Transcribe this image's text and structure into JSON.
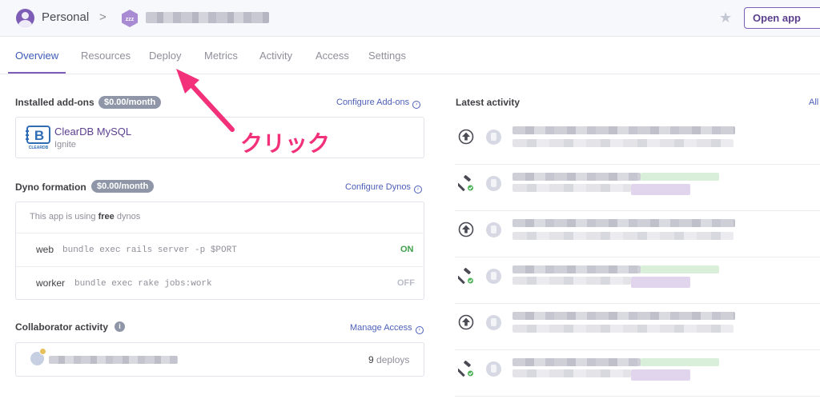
{
  "header": {
    "account_label": "Personal",
    "breadcrumb_separator": ">",
    "app_badge_text": "zzz",
    "open_app_label": "Open app"
  },
  "tabs": [
    {
      "label": "Overview",
      "active": true
    },
    {
      "label": "Resources",
      "active": false
    },
    {
      "label": "Deploy",
      "active": false
    },
    {
      "label": "Metrics",
      "active": false
    },
    {
      "label": "Activity",
      "active": false
    },
    {
      "label": "Access",
      "active": false
    },
    {
      "label": "Settings",
      "active": false
    }
  ],
  "addons": {
    "title": "Installed add-ons",
    "price": "$0.00/month",
    "link": "Configure Add-ons",
    "items": [
      {
        "name": "ClearDB MySQL",
        "plan": "Ignite",
        "logo_text": "CLEARDB",
        "logo_letter": "B"
      }
    ]
  },
  "dynos": {
    "title": "Dyno formation",
    "price": "$0.00/month",
    "link": "Configure Dynos",
    "note_prefix": "This app is using ",
    "note_bold": "free",
    "note_suffix": " dynos",
    "items": [
      {
        "type": "web",
        "command": "bundle exec rails server -p $PORT",
        "state": "ON"
      },
      {
        "type": "worker",
        "command": "bundle exec rake jobs:work",
        "state": "OFF"
      }
    ]
  },
  "collaborators": {
    "title": "Collaborator activity",
    "info_glyph": "i",
    "link": "Manage Access",
    "items": [
      {
        "count": "9",
        "suffix": " deploys"
      }
    ]
  },
  "activity": {
    "title": "Latest activity",
    "all_link": "All",
    "rows": [
      "deploy",
      "build",
      "deploy",
      "build",
      "deploy",
      "build"
    ]
  },
  "annotation": {
    "text": "クリック"
  },
  "colors": {
    "brand_purple": "#7d5db5",
    "link_blue": "#4d5fb8",
    "on_green": "#3fa14a",
    "off_gray": "#b9bcc8",
    "annotation_pink": "#f2317a"
  }
}
